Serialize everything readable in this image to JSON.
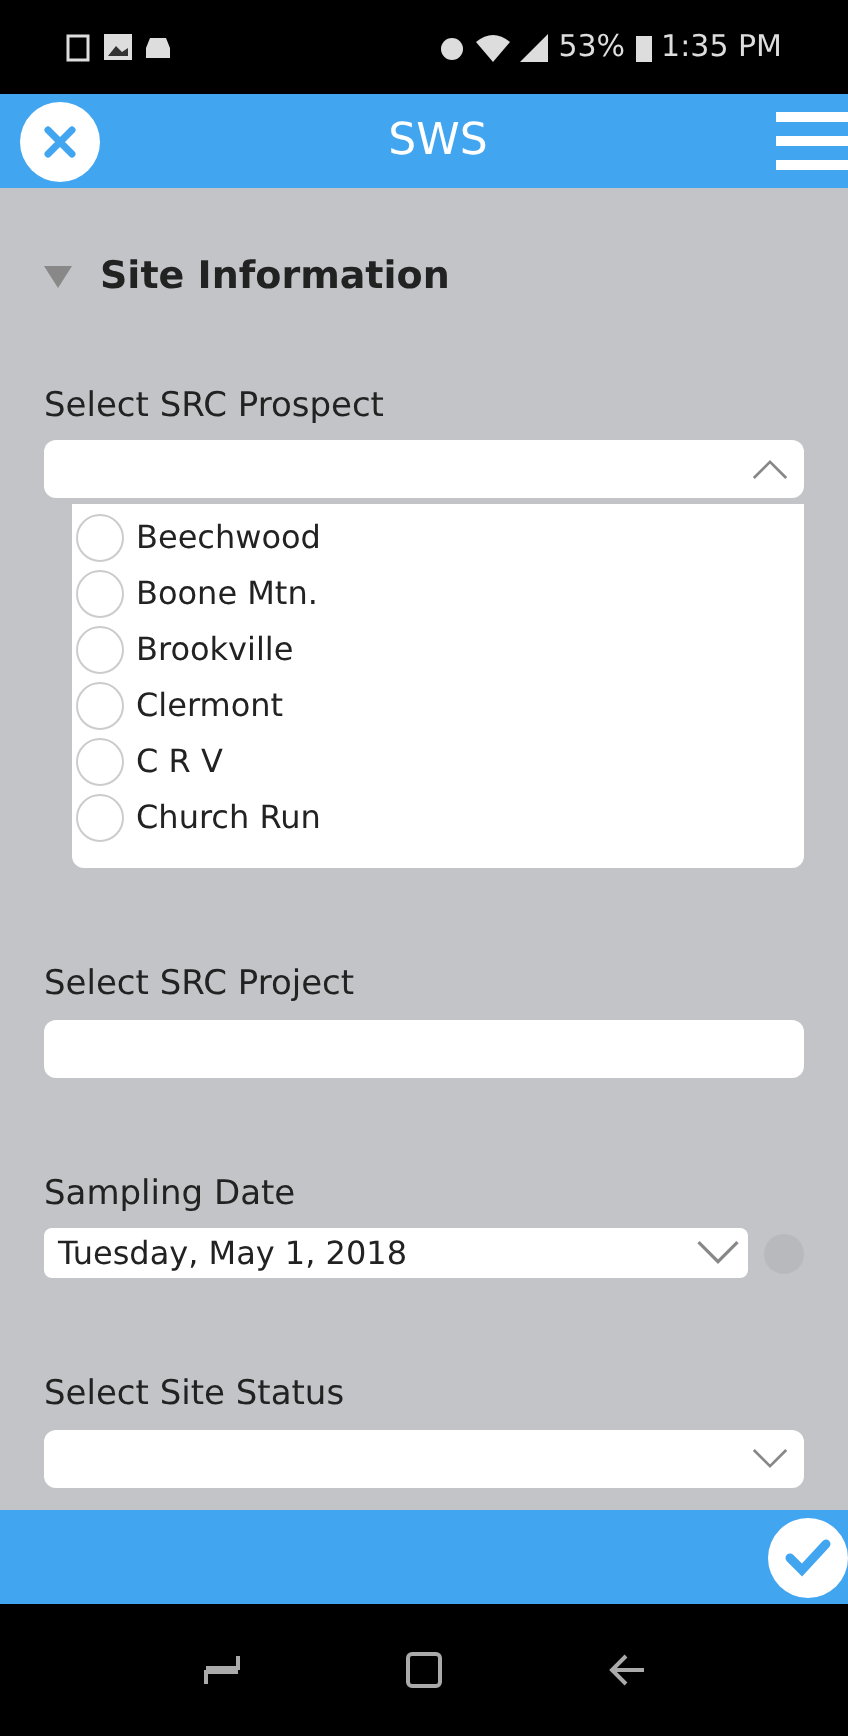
{
  "status_bar": {
    "battery": "53%",
    "time": "1:35 PM"
  },
  "header": {
    "title": "SWS"
  },
  "section": {
    "title": "Site Information",
    "expanded": true
  },
  "fields": [
    {
      "kind": "list",
      "label": "Select SRC Prospect",
      "open": true,
      "options": [
        {
          "label": "Beechwood",
          "selected": false
        },
        {
          "label": "Boone Mtn.",
          "selected": false
        },
        {
          "label": "Brookville",
          "selected": false
        },
        {
          "label": "Clermont",
          "selected": false
        },
        {
          "label": "C R V",
          "selected": false
        },
        {
          "label": "Church Run",
          "selected": false
        }
      ]
    },
    {
      "kind": "text",
      "label": "Select SRC Project"
    },
    {
      "kind": "date",
      "label": "Sampling Date",
      "value": "Tuesday, May 1, 2018"
    },
    {
      "kind": "select",
      "label": "Select Site Status"
    }
  ]
}
